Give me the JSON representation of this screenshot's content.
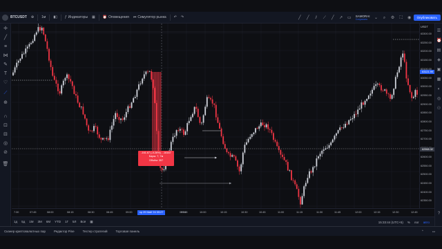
{
  "toolbar": {
    "symbol": "BTCUSDT",
    "interval": "1м",
    "indicators_label": "Индикаторы",
    "alerts_label": "Оповещения",
    "replay_label": "Симулятор рынка",
    "user_name": "SAMORAI",
    "user_status": "Сохранить",
    "publish_label": "Опубликовать"
  },
  "price_scale": {
    "currency": "USDT",
    "ticks": [
      "63300.00",
      "63250.00",
      "63200.00",
      "63150.00",
      "63100.00",
      "63050.00",
      "63000.00",
      "62950.00",
      "62900.00",
      "62850.00",
      "62800.00",
      "62750.00",
      "62700.00",
      "62650.00",
      "62600.00",
      "62550.00",
      "62500.00",
      "62450.00",
      "62400.00",
      "62350.00"
    ],
    "badge_blue": "63121.99",
    "badge_current": "62968.32"
  },
  "time_scale": {
    "ticks": [
      "7:30",
      "07:45",
      "08:00",
      "08:15",
      "08:30",
      "08:45",
      "09:00",
      "09:30",
      "09:45",
      "10:00",
      "10:15",
      "10:30",
      "10:45",
      "11:00",
      "11:15",
      "11:30",
      "11:45",
      "12:00",
      "12:15",
      "12:30",
      "12:45"
    ],
    "cursor_label": "ср 29 Май '24  09:27"
  },
  "tooltip": {
    "line1": "-161.67 (-0.26%) , -16167",
    "line2": "Бары: 7, 7м",
    "line3": "Объём: 357"
  },
  "range_bar": {
    "items": [
      "1д",
      "5д",
      "1М",
      "3М",
      "6М",
      "YTD",
      "1Г",
      "5Л",
      "Всё"
    ],
    "clock": "15:33:44 (UTC+5)",
    "percent_label": "%",
    "log_label": "лог",
    "auto_label": "авто"
  },
  "bottom_tabs": {
    "items": [
      "Сканер криптовалютных пар",
      "Редактор Pine",
      "Тестер стратегий",
      "Торговая панель"
    ]
  },
  "colors": {
    "bg": "#0e0f13",
    "panel": "#131722",
    "up": "#d1d4dc",
    "down": "#f23645",
    "accent": "#2962ff",
    "measure": "#f23645"
  },
  "icons": {
    "left": [
      "crosshair-icon",
      "trend-line-icon",
      "fib-icon",
      "pattern-icon",
      "brush-icon",
      "text-icon",
      "heart-icon",
      "ruler-icon",
      "zoom-icon",
      "magnet-icon",
      "lock-icon",
      "eye-icon",
      "trash-icon"
    ],
    "right": [
      "watchlist-icon",
      "alerts-icon",
      "chat-icon",
      "layers-icon",
      "news-icon",
      "calendar-icon",
      "ideas-icon",
      "streams-icon",
      "notifications-icon",
      "help-icon"
    ]
  }
}
